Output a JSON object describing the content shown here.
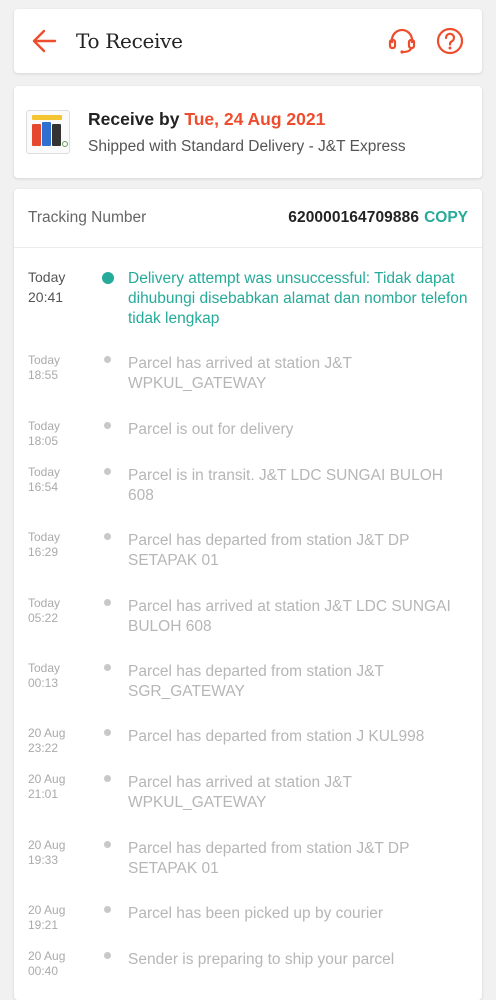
{
  "header": {
    "title": "To Receive",
    "accent": "#ee4d2d",
    "back_icon": "arrow-left-icon",
    "support_icon": "headset-icon",
    "help_icon": "question-circle-icon"
  },
  "delivery": {
    "receive_prefix": "Receive by ",
    "receive_date": "Tue, 24 Aug 2021",
    "shipped_text": "Shipped with Standard Delivery  - J&T Express"
  },
  "tracking": {
    "label": "Tracking Number",
    "number": "620000164709886",
    "copy_label": "COPY",
    "accent": "#26aa99"
  },
  "events": [
    {
      "day": "Today",
      "time": "20:41",
      "text": "Delivery attempt was unsuccessful: Tidak dapat dihubungi disebabkan alamat dan nombor telefon tidak lengkap",
      "active": true
    },
    {
      "day": "Today",
      "time": "18:55",
      "text": "Parcel has arrived at station J&T WPKUL_GATEWAY"
    },
    {
      "day": "Today",
      "time": "18:05",
      "text": "Parcel is out for delivery"
    },
    {
      "day": "Today",
      "time": "16:54",
      "text": "Parcel is in transit. J&T LDC SUNGAI BULOH 608"
    },
    {
      "day": "Today",
      "time": "16:29",
      "text": "Parcel has departed from station J&T DP SETAPAK 01"
    },
    {
      "day": "Today",
      "time": "05:22",
      "text": "Parcel has arrived at station J&T LDC SUNGAI BULOH 608"
    },
    {
      "day": "Today",
      "time": "00:13",
      "text": "Parcel has departed from station J&T SGR_GATEWAY"
    },
    {
      "day": "20 Aug",
      "time": "23:22",
      "text": "Parcel has departed from station J KUL998"
    },
    {
      "day": "20 Aug",
      "time": "21:01",
      "text": "Parcel has arrived at station J&T WPKUL_GATEWAY"
    },
    {
      "day": "20 Aug",
      "time": "19:33",
      "text": "Parcel has departed from station J&T DP SETAPAK 01"
    },
    {
      "day": "20 Aug",
      "time": "19:21",
      "text": "Parcel has been picked up by courier"
    },
    {
      "day": "20 Aug",
      "time": "00:40",
      "text": "Sender is preparing to ship your parcel"
    }
  ]
}
